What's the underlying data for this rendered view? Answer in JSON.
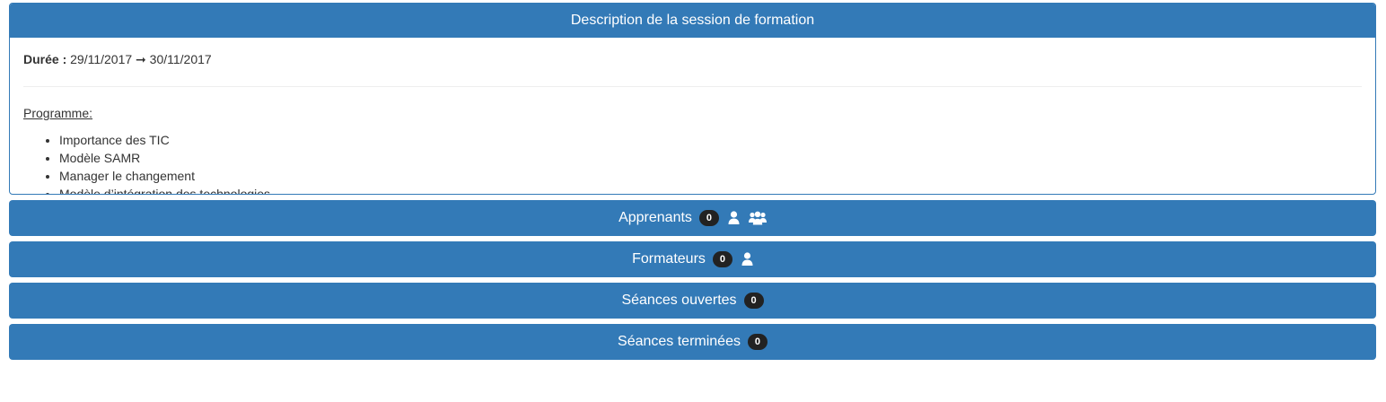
{
  "description_panel": {
    "title": "Description de la session de formation",
    "duration_label": "Durée :",
    "duration_value": "29/11/2017 ➞ 30/11/2017",
    "programme_label": "Programme:",
    "programme_items": [
      "Importance des TIC",
      "Modèle SAMR",
      "Manager le changement",
      "Modèle d’intégration des technologies"
    ]
  },
  "sections": [
    {
      "label": "Apprenants",
      "count": "0",
      "icons": [
        "user-icon",
        "users-group-icon"
      ]
    },
    {
      "label": "Formateurs",
      "count": "0",
      "icons": [
        "user-icon"
      ]
    },
    {
      "label": "Séances ouvertes",
      "count": "0",
      "icons": []
    },
    {
      "label": "Séances terminées",
      "count": "0",
      "icons": []
    }
  ],
  "colors": {
    "primary": "#337ab7",
    "badge": "#222222",
    "text": "#333333"
  }
}
